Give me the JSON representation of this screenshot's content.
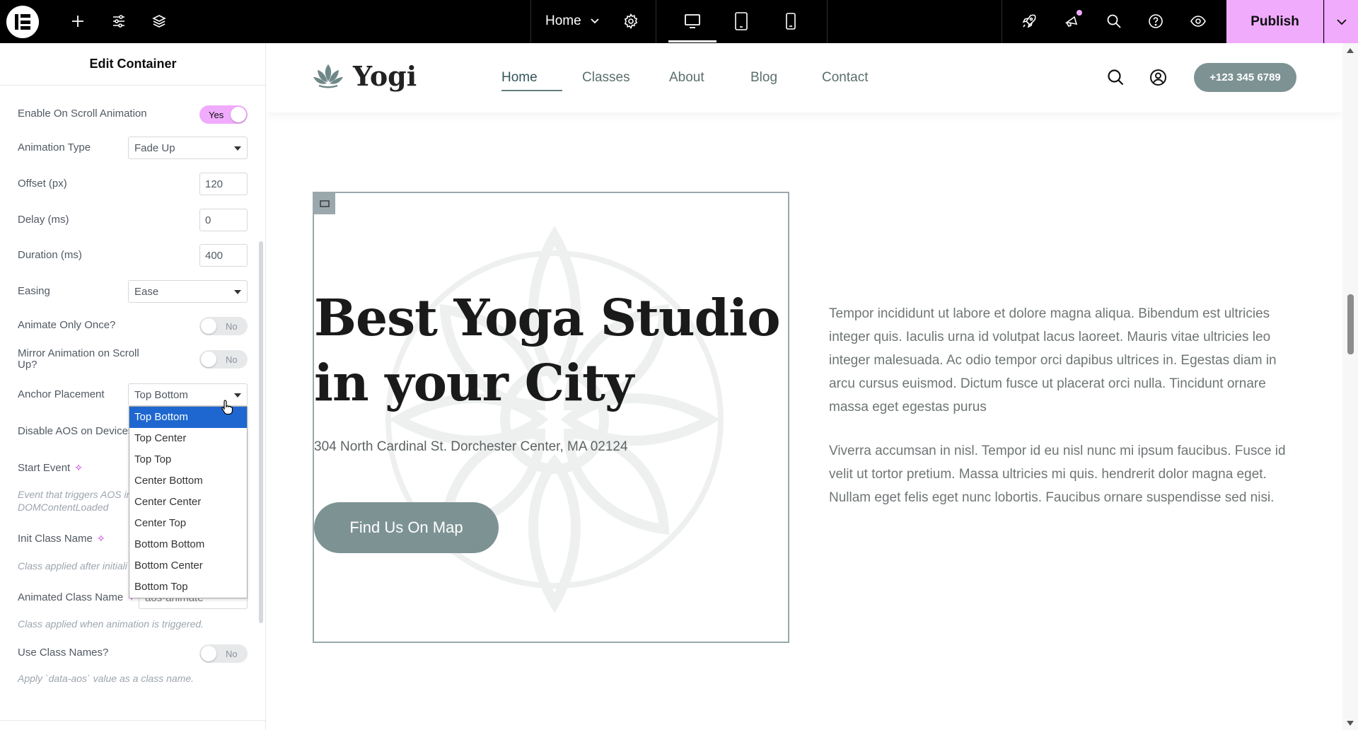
{
  "topbar": {
    "page_name": "Home",
    "publish_label": "Publish",
    "accent_color": "#f0abfc"
  },
  "panel": {
    "title": "Edit Container",
    "scroll_animation": {
      "label": "Enable On Scroll Animation",
      "value": "Yes"
    },
    "animation_type": {
      "label": "Animation Type",
      "value": "Fade Up"
    },
    "offset": {
      "label": "Offset (px)",
      "value": "120"
    },
    "delay": {
      "label": "Delay (ms)",
      "value": "0"
    },
    "duration": {
      "label": "Duration (ms)",
      "value": "400"
    },
    "easing": {
      "label": "Easing",
      "value": "Ease"
    },
    "animate_once": {
      "label": "Animate Only Once?",
      "value": "No"
    },
    "mirror": {
      "label_line1": "Mirror Animation on Scroll",
      "label_line2": "Up?",
      "value": "No"
    },
    "anchor_placement": {
      "label": "Anchor Placement",
      "value": "Top Bottom",
      "options": [
        "Top Bottom",
        "Top Center",
        "Top Top",
        "Center Bottom",
        "Center Center",
        "Center Top",
        "Bottom Bottom",
        "Bottom Center",
        "Bottom Top"
      ]
    },
    "disable_aos": {
      "label": "Disable AOS on Devices"
    },
    "start_event": {
      "label": "Start Event",
      "desc_line1": "Event that triggers AOS in",
      "desc_line2": "DOMContentLoaded"
    },
    "init_class": {
      "label": "Init Class Name",
      "desc": "Class applied after initiali"
    },
    "animated_class": {
      "label": "Animated Class Name",
      "value": "aos-animate",
      "desc": "Class applied when animation is triggered."
    },
    "use_class_names": {
      "label": "Use Class Names?",
      "value": "No",
      "desc": "Apply `data-aos` value as a class name."
    }
  },
  "site": {
    "brand": "Yogi",
    "nav": [
      "Home",
      "Classes",
      "About",
      "Blog",
      "Contact"
    ],
    "phone": "+123 345 6789",
    "hero_title_line1": "Best Yoga Studio",
    "hero_title_line2": "in your City",
    "address": "304 North Cardinal St. Dorchester Center, MA 02124",
    "map_button": "Find Us On Map",
    "para1": "Tempor incididunt ut labore et dolore magna aliqua. Bibendum est ultricies integer quis. Iaculis urna id volutpat lacus laoreet. Mauris vitae ultricies leo integer malesuada. Ac odio tempor orci dapibus ultrices in. Egestas diam in arcu cursus euismod. Dictum fusce ut placerat orci nulla. Tincidunt ornare massa eget egestas purus",
    "para2": "Viverra accumsan in nisl. Tempor id eu nisl nunc mi ipsum faucibus. Fusce id velit ut tortor pretium. Massa ultricies mi quis. hendrerit dolor magna eget. Nullam eget felis eget nunc lobortis. Faucibus ornare suspendisse sed nisi."
  }
}
